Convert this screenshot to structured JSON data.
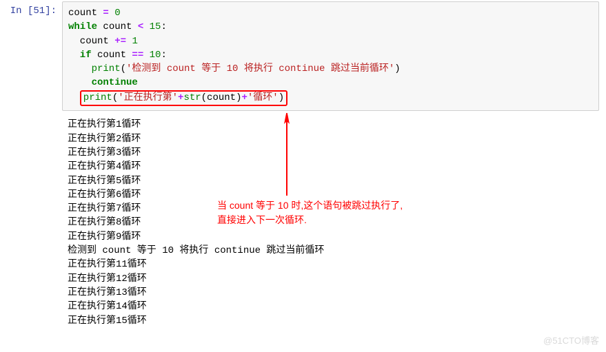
{
  "prompt": {
    "label": "In  [51]:"
  },
  "code": {
    "l1_var": "count ",
    "l1_eq": "= ",
    "l1_val": "0",
    "l2_kw": "while",
    "l2_var": " count ",
    "l2_op": "< ",
    "l2_val": "15",
    "l2_colon": ":",
    "l3_var": "count ",
    "l3_op": "+= ",
    "l3_val": "1",
    "l4_kw": "if",
    "l4_var": " count ",
    "l4_op": "== ",
    "l4_val": "10",
    "l4_colon": ":",
    "l5_fn": "print",
    "l5_p1": "(",
    "l5_str": "'检测到 count 等于 10 将执行 continue 跳过当前循环'",
    "l5_p2": ")",
    "l6_kw": "continue",
    "l7_fn": "print",
    "l7_p1": "(",
    "l7_str1": "'正在执行第'",
    "l7_plus1": "+",
    "l7_strfn": "str",
    "l7_p2": "(count)",
    "l7_plus2": "+",
    "l7_str2": "'循环'",
    "l7_p3": ")"
  },
  "output": {
    "lines": [
      "正在执行第1循环",
      "正在执行第2循环",
      "正在执行第3循环",
      "正在执行第4循环",
      "正在执行第5循环",
      "正在执行第6循环",
      "正在执行第7循环",
      "正在执行第8循环",
      "正在执行第9循环",
      "检测到 count 等于 10 将执行 continue 跳过当前循环",
      "正在执行第11循环",
      "正在执行第12循环",
      "正在执行第13循环",
      "正在执行第14循环",
      "正在执行第15循环"
    ]
  },
  "annotation": {
    "line1": "当 count 等于 10 时,这个语句被跳过执行了,",
    "line2": "直接进入下一次循环."
  },
  "watermark": "@51CTO博客"
}
